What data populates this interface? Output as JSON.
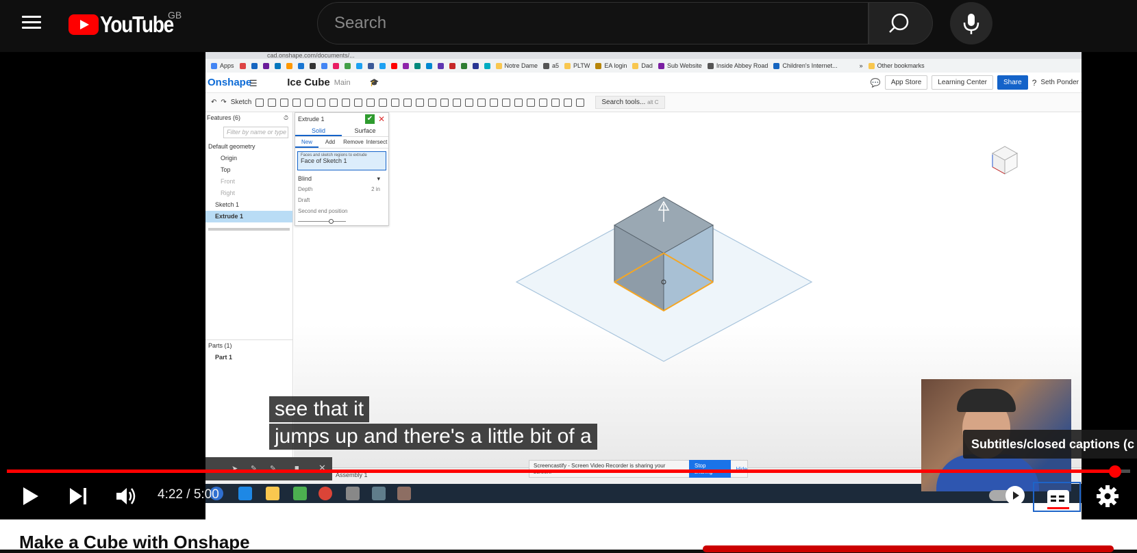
{
  "header": {
    "logo_text": "YouTube",
    "region": "GB",
    "search_placeholder": "Search"
  },
  "video": {
    "browser_url": "cad.onshape.com/documents/...",
    "bookmarks": [
      "Apps",
      "Notre Dame",
      "a5",
      "PLTW",
      "EA login",
      "Dad",
      "Sub Website",
      "Inside Abbey Road",
      "Children's Internet...",
      "»",
      "Other bookmarks"
    ],
    "onshape": {
      "logo": "Onshape",
      "doc_title": "Ice Cube",
      "workspace": "Main",
      "app_store": "App Store",
      "learning_center": "Learning Center",
      "share": "Share",
      "user": "Seth Ponder",
      "sketch_btn": "Sketch",
      "search_tools": "Search tools...",
      "search_tools_shortcut": "alt C",
      "features_header": "Features (6)",
      "filter_placeholder": "Filter by name or type",
      "tree": [
        "Default geometry",
        "Origin",
        "Top",
        "Front",
        "Right",
        "Sketch 1",
        "Extrude 1"
      ],
      "parts_header": "Parts (1)",
      "part": "Part 1",
      "dialog": {
        "title": "Extrude 1",
        "tabs": [
          "Solid",
          "Surface"
        ],
        "ops": [
          "New",
          "Add",
          "Remove",
          "Intersect"
        ],
        "faces_label": "Faces and sketch regions to extrude",
        "faces_value": "Face of Sketch 1",
        "end_type": "Blind",
        "depth_label": "Depth",
        "depth_value": "2 in",
        "draft": "Draft",
        "second_end": "Second end position"
      },
      "assembly_tab": "Assembly 1",
      "sharing_text": "Screencastify - Screen Video Recorder is sharing your screen.",
      "stop_sharing": "Stop sharing",
      "hide": "Hide"
    }
  },
  "captions": [
    "see that it",
    "jumps up and there's a little bit of a"
  ],
  "tooltip": "Subtitles/closed captions (c",
  "player": {
    "current_time": "4:22",
    "duration": "5:00",
    "progress_fraction": 0.9867
  },
  "below": {
    "title": "Make a Cube with Onshape"
  },
  "colors": {
    "accent_red": "#ff0000",
    "onshape_blue": "#1463c9"
  }
}
